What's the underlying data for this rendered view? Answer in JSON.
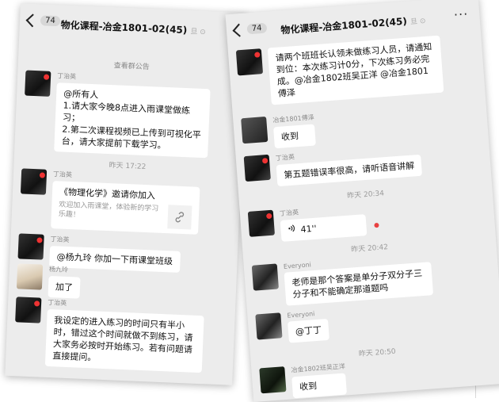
{
  "left_chat": {
    "back_count": "74",
    "title": "物化课程-冶金1801-02(45)",
    "title_suffix": "旦 ⊙",
    "notice_link": "查看群公告",
    "timestamp_1": "昨天 17:22",
    "messages": [
      {
        "sender": "丁治英",
        "text": "@所有人\n1.请大家今晚8点进入雨课堂做练习；\n2.第二次课程视频已上传到可视化平台，请大家提前下载学习。"
      },
      {
        "sender": "丁治英",
        "card_title": "《物理化学》邀请你加入",
        "card_desc": "欢迎加入雨课堂，体验新的学习乐趣！"
      },
      {
        "sender": "丁治英",
        "text": "@杨九玲 你加一下雨课堂班级"
      },
      {
        "sender": "杨九玲",
        "text": "加了"
      },
      {
        "sender": "丁治英",
        "text": "我设定的进入练习的时间只有半小时，错过这个时间就做不到练习，请大家务必按时开始练习。若有问题请直接提问。"
      }
    ]
  },
  "right_chat": {
    "back_count": "74",
    "title": "物化课程-冶金1801-02(45)",
    "title_suffix": "旦 ⊙",
    "more": "···",
    "timestamp_1": "昨天 20:34",
    "timestamp_2": "昨天 20:42",
    "timestamp_3": "昨天 20:50",
    "messages": [
      {
        "sender": "",
        "text": "请两个班班长认领未做练习人员，请通知到位：本次练习计0分，下次练习务必完成。@冶金1802班吴正洋 @冶金1801傅泽"
      },
      {
        "sender": "冶金1801傅泽",
        "text": "收到"
      },
      {
        "sender": "丁治英",
        "text": "第五题错误率很高，请听语音讲解"
      },
      {
        "sender": "丁治英",
        "text": "41''"
      },
      {
        "sender": "Everyoni",
        "text": "老师是那个答案是单分子双分子三分子和不能确定那道题吗"
      },
      {
        "sender": "Everyoni",
        "text": "@丁丁"
      },
      {
        "sender": "冶金1802班吴正洋",
        "text": "收到"
      }
    ]
  },
  "icons": {
    "voice": "voice-icon",
    "link": "link-icon",
    "back": "back-chevron-icon"
  }
}
